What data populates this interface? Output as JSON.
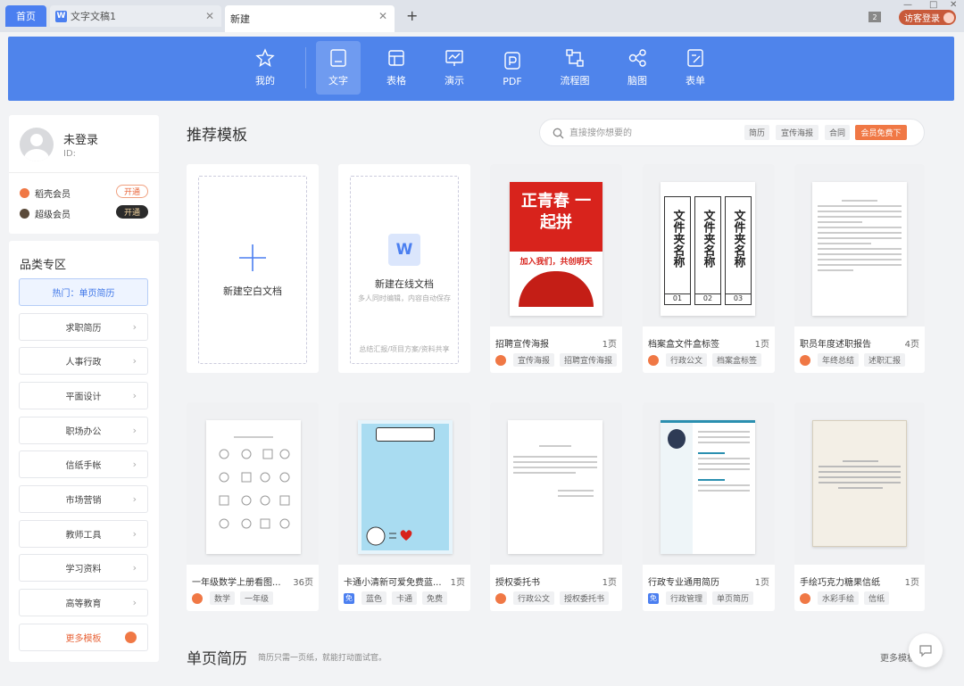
{
  "tabs": {
    "home": "首页",
    "doc": "文字文稿1",
    "new": "新建",
    "w": "W"
  },
  "login": {
    "label": "访客登录",
    "badge": "2"
  },
  "ribbon": [
    {
      "label": "我的",
      "icon": "star-icon"
    },
    {
      "label": "文字",
      "icon": "text-doc-icon"
    },
    {
      "label": "表格",
      "icon": "table-icon"
    },
    {
      "label": "演示",
      "icon": "presentation-icon"
    },
    {
      "label": "PDF",
      "icon": "pdf-icon"
    },
    {
      "label": "流程图",
      "icon": "flowchart-icon"
    },
    {
      "label": "脑图",
      "icon": "mindmap-icon"
    },
    {
      "label": "表单",
      "icon": "form-icon"
    }
  ],
  "user": {
    "name": "未登录",
    "id": "ID:"
  },
  "vip": [
    {
      "label": "稻壳会员",
      "btn": "开通"
    },
    {
      "label": "超级会员",
      "btn": "开通"
    }
  ],
  "category": {
    "title": "品类专区",
    "hot": "热门：单页简历",
    "items": [
      "求职简历",
      "人事行政",
      "平面设计",
      "职场办公",
      "信纸手帐",
      "市场营销",
      "教师工具",
      "学习资料",
      "高等教育"
    ],
    "more": "更多模板"
  },
  "main": {
    "title": "推荐模板",
    "search_placeholder": "直接搜你想要的",
    "search_tags": [
      "简历",
      "宣传海报",
      "合同"
    ],
    "vip_free": "会员免费下"
  },
  "blank_cards": {
    "new_blank": "新建空白文档",
    "new_online": "新建在线文档",
    "online_sub": "多人同时编辑，内容自动保存",
    "online_foot": "总结汇报/项目方案/资料共享",
    "w": "W"
  },
  "templates": [
    {
      "title": "招聘宣传海报",
      "pages": "1页",
      "icon": "fire",
      "tags": [
        "宣传海报",
        "招聘宣传海报"
      ]
    },
    {
      "title": "档案盒文件盒标签",
      "pages": "1页",
      "icon": "fire",
      "tags": [
        "行政公文",
        "档案盒标签"
      ]
    },
    {
      "title": "职员年度述职报告",
      "pages": "4页",
      "icon": "fire",
      "tags": [
        "年终总结",
        "述职汇报"
      ]
    },
    {
      "title": "一年级数学上册看图...",
      "pages": "36页",
      "icon": "fire",
      "tags": [
        "数学",
        "一年级"
      ]
    },
    {
      "title": "卡通小清新可爱免费蓝...",
      "pages": "1页",
      "icon": "free",
      "tags": [
        "蓝色",
        "卡通",
        "免费"
      ]
    },
    {
      "title": "授权委托书",
      "pages": "1页",
      "icon": "fire",
      "tags": [
        "行政公文",
        "授权委托书"
      ]
    },
    {
      "title": "行政专业通用简历",
      "pages": "1页",
      "icon": "free",
      "tags": [
        "行政管理",
        "单页简历"
      ]
    },
    {
      "title": "手绘巧克力糖果信纸",
      "pages": "1页",
      "icon": "fire",
      "tags": [
        "水彩手绘",
        "信纸"
      ]
    }
  ],
  "free_label": "免",
  "thumb_text": {
    "poster_big": "正青春 一起拼",
    "poster_slogan": "加入我们，共创明天",
    "folder_label": "文件夹名称",
    "folder_nums": [
      "01",
      "02",
      "03"
    ]
  },
  "section2": {
    "title": "单页简历",
    "subtitle": "简历只需一页纸，就能打动面试官。",
    "more": "更多模板"
  },
  "colors": {
    "brand": "#4f84eb",
    "accent": "#f07845"
  }
}
